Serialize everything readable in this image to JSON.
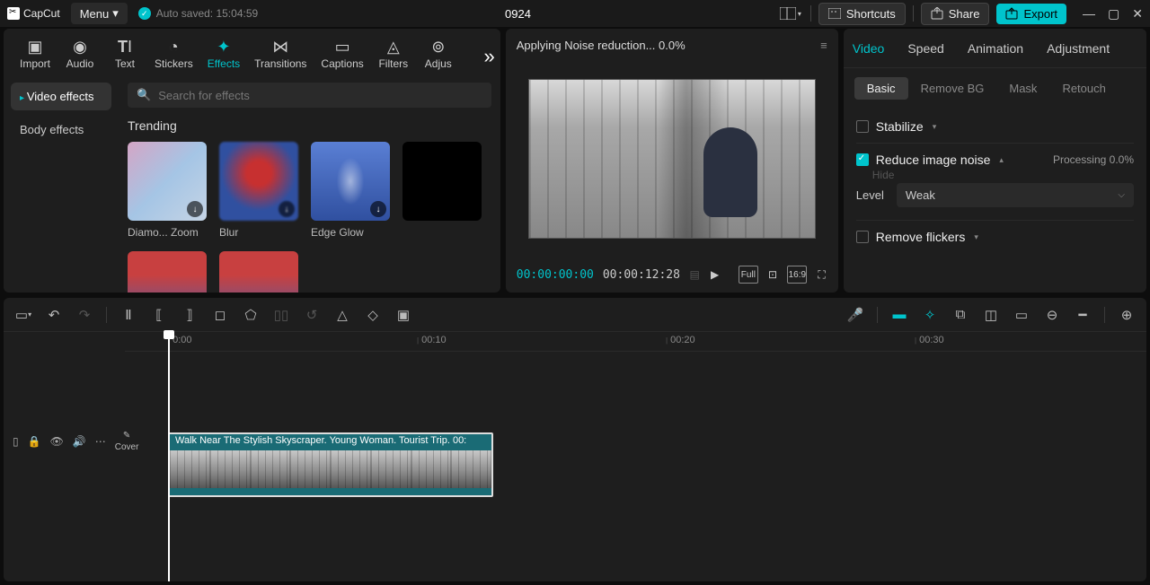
{
  "titlebar": {
    "brand": "CapCut",
    "menu": "Menu",
    "autosave": "Auto saved: 15:04:59",
    "project": "0924",
    "shortcuts": "Shortcuts",
    "share": "Share",
    "export": "Export"
  },
  "topTabs": {
    "import": "Import",
    "audio": "Audio",
    "text": "Text",
    "stickers": "Stickers",
    "effects": "Effects",
    "transitions": "Transitions",
    "captions": "Captions",
    "filters": "Filters",
    "adjust": "Adjus"
  },
  "effectsPanel": {
    "sub1": "Video effects",
    "sub2": "Body effects",
    "searchPlaceholder": "Search for effects",
    "trending": "Trending",
    "items": {
      "e0": "Diamo... Zoom",
      "e1": "Blur",
      "e2": "Edge Glow"
    }
  },
  "preview": {
    "status": "Applying Noise reduction... 0.0%",
    "current": "00:00:00:00",
    "total": "00:00:12:28",
    "fullLabel": "Full",
    "ratioLabel": "16:9"
  },
  "rightPanel": {
    "tabs": {
      "video": "Video",
      "speed": "Speed",
      "animation": "Animation",
      "adjustment": "Adjustment"
    },
    "sub": {
      "basic": "Basic",
      "removebg": "Remove BG",
      "mask": "Mask",
      "retouch": "Retouch"
    },
    "stabilize": "Stabilize",
    "reduceNoise": "Reduce image noise",
    "processing": "Processing 0.0%",
    "hide": "Hide",
    "level": "Level",
    "levelValue": "Weak",
    "removeFlickers": "Remove flickers"
  },
  "timeline": {
    "marks": {
      "m0": "0:00",
      "m10": "00:10",
      "m20": "00:20",
      "m30": "00:30"
    },
    "clipLabel": "Walk Near The Stylish Skyscraper. Young Woman. Tourist Trip.   00:",
    "cover": "Cover"
  }
}
